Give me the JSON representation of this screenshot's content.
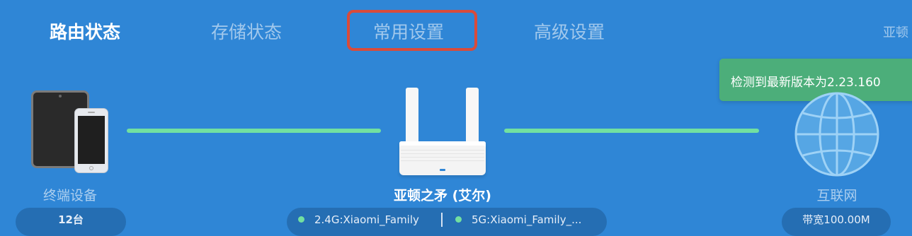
{
  "nav": {
    "items": [
      {
        "label": "路由状态",
        "active": true
      },
      {
        "label": "存储状态",
        "active": false
      },
      {
        "label": "常用设置",
        "active": false,
        "highlighted": true
      },
      {
        "label": "高级设置",
        "active": false
      }
    ],
    "router_name_partial": "亚顿"
  },
  "toast": {
    "text": "检测到最新版本为2.23.160"
  },
  "devices": {
    "label": "终端设备",
    "count": "12台",
    "icon": "tablet-phone-icon"
  },
  "router": {
    "name": "亚顿之矛 (艾尔)",
    "icon": "router-icon",
    "wifi_24": "2.4G:Xiaomi_Family",
    "wifi_5": "5G:Xiaomi_Family_..."
  },
  "internet": {
    "label": "互联网",
    "bandwidth": "带宽100.00M",
    "icon": "globe-icon"
  },
  "colors": {
    "background": "#2f86d6",
    "connection_line": "#72e0a0",
    "toast": "#4cae7a",
    "highlight_border": "#d94b3a",
    "pill": "#256eb3"
  }
}
